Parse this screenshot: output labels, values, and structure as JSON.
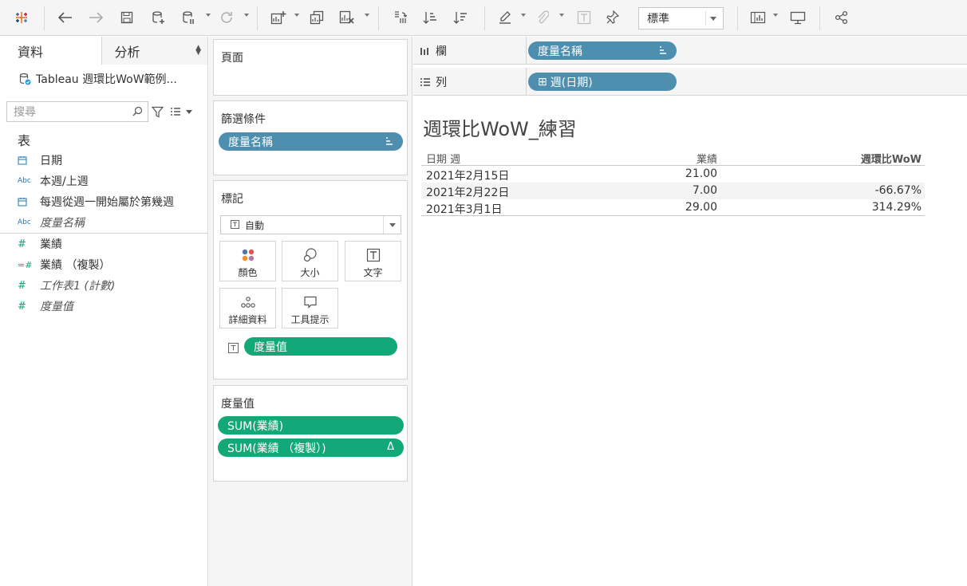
{
  "toolbar": {
    "fit_value": "標準"
  },
  "data_pane": {
    "tab_data": "資料",
    "tab_analysis": "分析",
    "datasource": "Tableau 週環比WoW範例...",
    "search_placeholder": "搜尋",
    "section_table": "表",
    "dimensions": [
      {
        "icon": "date",
        "label": "日期"
      },
      {
        "icon": "Abc",
        "label": "本週/上週"
      },
      {
        "icon": "date",
        "label": "每週從週一開始屬於第幾週"
      },
      {
        "icon": "Abc",
        "label": "度量名稱"
      }
    ],
    "measures": [
      {
        "icon": "#",
        "label": "業績"
      },
      {
        "icon": "=#",
        "label": "業績 （複製）"
      },
      {
        "icon": "#",
        "label": "工作表1 (計數)"
      },
      {
        "icon": "#",
        "label": "度量值"
      }
    ]
  },
  "cards": {
    "pages_title": "頁面",
    "filters_title": "篩選條件",
    "filter_pill": "度量名稱",
    "marks_title": "標記",
    "mark_type": "自動",
    "mark_buttons": [
      "顏色",
      "大小",
      "文字",
      "詳細資料",
      "工具提示"
    ],
    "text_pill": "度量值",
    "measure_values_title": "度量值",
    "mv_pills": [
      "SUM(業績)",
      "SUM(業績 （複製）)"
    ],
    "delta_symbol": "Δ"
  },
  "shelves": {
    "columns_label": "欄",
    "columns_pill": "度量名稱",
    "rows_label": "列",
    "rows_pill": "週(日期)",
    "rows_plus": "⊞"
  },
  "view": {
    "title": "週環比WoW_練習",
    "headers": [
      "日期 週",
      "業績",
      "週環比WoW"
    ],
    "rows": [
      [
        "2021年2月15日",
        "21.00",
        ""
      ],
      [
        "2021年2月22日",
        "7.00",
        "-66.67%"
      ],
      [
        "2021年3月1日",
        "29.00",
        "314.29%"
      ]
    ]
  }
}
